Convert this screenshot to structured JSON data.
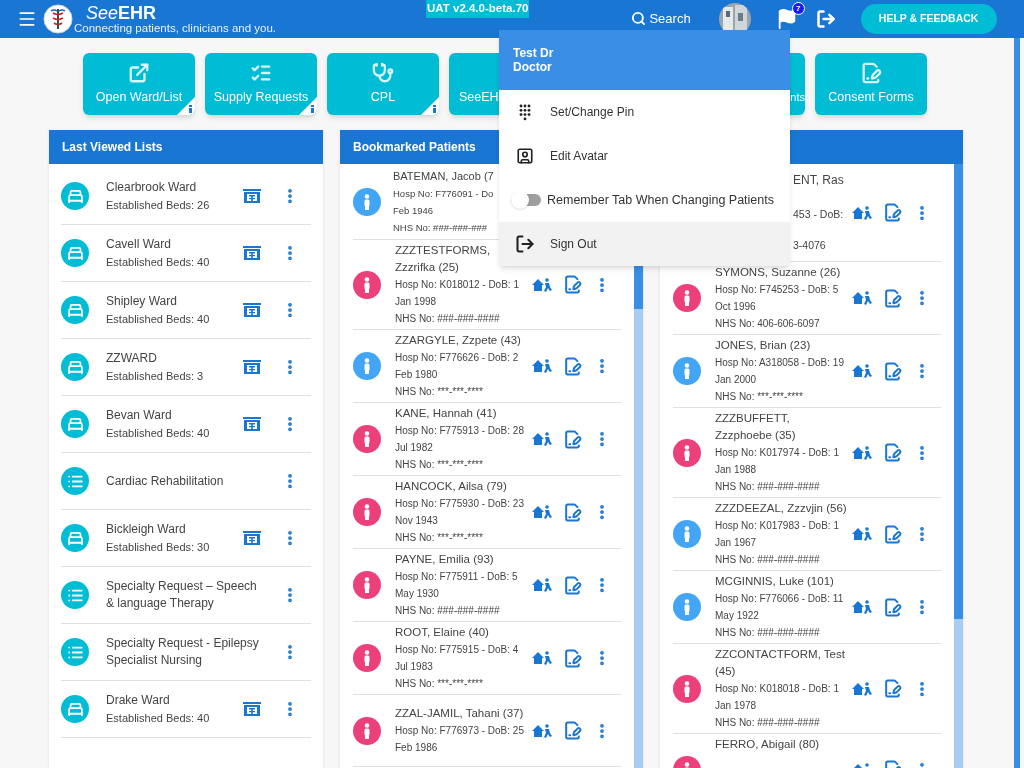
{
  "header": {
    "brand": {
      "light": "See",
      "bold": "EHR"
    },
    "tagline": "Connecting patients, clinicians and you.",
    "version": "UAT v2.4.0-beta.70",
    "search": "Search",
    "flag_count": "7",
    "help_button": "HELP & FEEDBACK"
  },
  "tiles": [
    {
      "label": "Open Ward/List",
      "info": true,
      "kind": "open"
    },
    {
      "label": "Supply Requests",
      "info": true,
      "kind": "checklist"
    },
    {
      "label": "CPL",
      "info": true,
      "kind": "stethoscope"
    },
    {
      "label": "SeeEH",
      "info": false,
      "kind": "cut_right"
    },
    {
      "label": "nts",
      "info": false,
      "kind": "cut_left"
    },
    {
      "label": "Consent Forms",
      "info": false,
      "kind": "form"
    }
  ],
  "last_viewed": {
    "title": "Last Viewed Lists",
    "items": [
      {
        "kind": "ward",
        "name": "Clearbrook Ward",
        "beds": "Established Beds: 26"
      },
      {
        "kind": "ward",
        "name": "Cavell Ward",
        "beds": "Established Beds: 40"
      },
      {
        "kind": "ward",
        "name": "Shipley Ward",
        "beds": "Established Beds: 40"
      },
      {
        "kind": "ward",
        "name": "ZZWARD",
        "beds": "Established Beds: 3"
      },
      {
        "kind": "ward",
        "name": "Bevan Ward",
        "beds": "Established Beds: 40"
      },
      {
        "kind": "list",
        "name": "Cardiac Rehabilitation"
      },
      {
        "kind": "ward",
        "name": "Bickleigh Ward",
        "beds": "Established Beds: 30"
      },
      {
        "kind": "list",
        "name": "Specialty Request – Speech & language Therapy"
      },
      {
        "kind": "list",
        "name": "Specialty Request - Epilepsy Specialist Nursing"
      },
      {
        "kind": "ward",
        "name": "Drake Ward",
        "beds": "Established Beds: 40"
      }
    ]
  },
  "bookmarked": {
    "title": "Bookmarked Patients",
    "patients": [
      {
        "kind": "cut_right",
        "color": "#42a5f5",
        "name": "BATEMAN, Jacob (7",
        "lines": [
          "Hosp No: F776091 - Do",
          "Feb 1946",
          "NHS No: ###-###-###"
        ]
      },
      {
        "kind": "full",
        "color": "#ec407a",
        "name": "ZZZTESTFORMS, Zzzrifka (25)",
        "hosp": "Hosp No: K018012 - DoB: 1 Jan 1998",
        "nhs": "NHS No: ###-###-####"
      },
      {
        "kind": "full",
        "color": "#42a5f5",
        "name": "ZZARGYLE, Zzpete (43)",
        "hosp": "Hosp No: F776626 - DoB: 2 Feb 1980",
        "nhs": "NHS No: ***-***-****"
      },
      {
        "kind": "full",
        "color": "#ec407a",
        "name": "KANE, Hannah (41)",
        "hosp": "Hosp No: F775913 - DoB: 28 Jul 1982",
        "nhs": "NHS No: ***-***-****"
      },
      {
        "kind": "full",
        "color": "#ec407a",
        "name": "HANCOCK, Ailsa (79)",
        "hosp": "Hosp No: F775930 - DoB: 23 Nov 1943",
        "nhs": "NHS No: ***-***-****"
      },
      {
        "kind": "full",
        "color": "#ec407a",
        "name": "PAYNE, Emilia (93)",
        "hosp": "Hosp No: F775911 - DoB: 5 May 1930",
        "nhs": "NHS No: ###-###-####"
      },
      {
        "kind": "full",
        "color": "#ec407a",
        "name": "ROOT, Elaine (40)",
        "hosp": "Hosp No: F775915 - DoB: 4 Jul 1983",
        "nhs": "NHS No: ***-***-****"
      },
      {
        "kind": "full",
        "color": "#ec407a",
        "name": "ZZAL-JAMIL, Tahani (37)",
        "hosp": "Hosp No: F776973 - DoB: 25 Feb 1986"
      }
    ]
  },
  "other_patients": {
    "patients": [
      {
        "kind": "cut_left",
        "name": "ENT, Ras",
        "lines": [
          "453 - DoB:",
          "3-4076"
        ]
      },
      {
        "kind": "full",
        "color": "#ec407a",
        "name": "SYMONS, Suzanne (26)",
        "hosp": "Hosp No: F745253 - DoB: 5 Oct 1996",
        "nhs": "NHS No: 406-606-6097"
      },
      {
        "kind": "full",
        "color": "#42a5f5",
        "name": "JONES, Brian (23)",
        "hosp": "Hosp No: A318058 - DoB: 19 Jan 2000",
        "nhs": "NHS No: ***-***-****"
      },
      {
        "kind": "full",
        "color": "#ec407a",
        "name": "ZZZBUFFETT, Zzzphoebe (35)",
        "hosp": "Hosp No: K017974 - DoB: 1 Jan 1988",
        "nhs": "NHS No: ###-###-####"
      },
      {
        "kind": "full",
        "color": "#42a5f5",
        "name": "ZZZDEEZAL, Zzzvjin (56)",
        "hosp": "Hosp No: K017983 - DoB: 1 Jan 1967",
        "nhs": "NHS No: ###-###-####"
      },
      {
        "kind": "full",
        "color": "#42a5f5",
        "name": "MCGINNIS, Luke (101)",
        "hosp": "Hosp No: F776066 - DoB: 11 May 1922",
        "nhs": "NHS No: ###-###-####"
      },
      {
        "kind": "full",
        "color": "#ec407a",
        "name": "ZZCONTACTFORM, Test (45)",
        "hosp": "Hosp No: K018018 - DoB: 1 Jan 1978",
        "nhs": "NHS No: ###-###-####"
      },
      {
        "kind": "full",
        "color": "#ec407a",
        "name": "FERRO, Abigail (80)"
      }
    ]
  },
  "user_menu": {
    "name": "Test Dr",
    "role": "Doctor",
    "items": [
      {
        "kind": "pin",
        "label": "Set/Change Pin",
        "selected": false
      },
      {
        "kind": "avatar",
        "label": "Edit Avatar",
        "selected": false
      },
      {
        "kind": "toggle",
        "label": "Remember Tab When Changing Patients",
        "on": false,
        "selected": false
      },
      {
        "kind": "signout",
        "label": "Sign Out",
        "selected": true
      }
    ]
  }
}
